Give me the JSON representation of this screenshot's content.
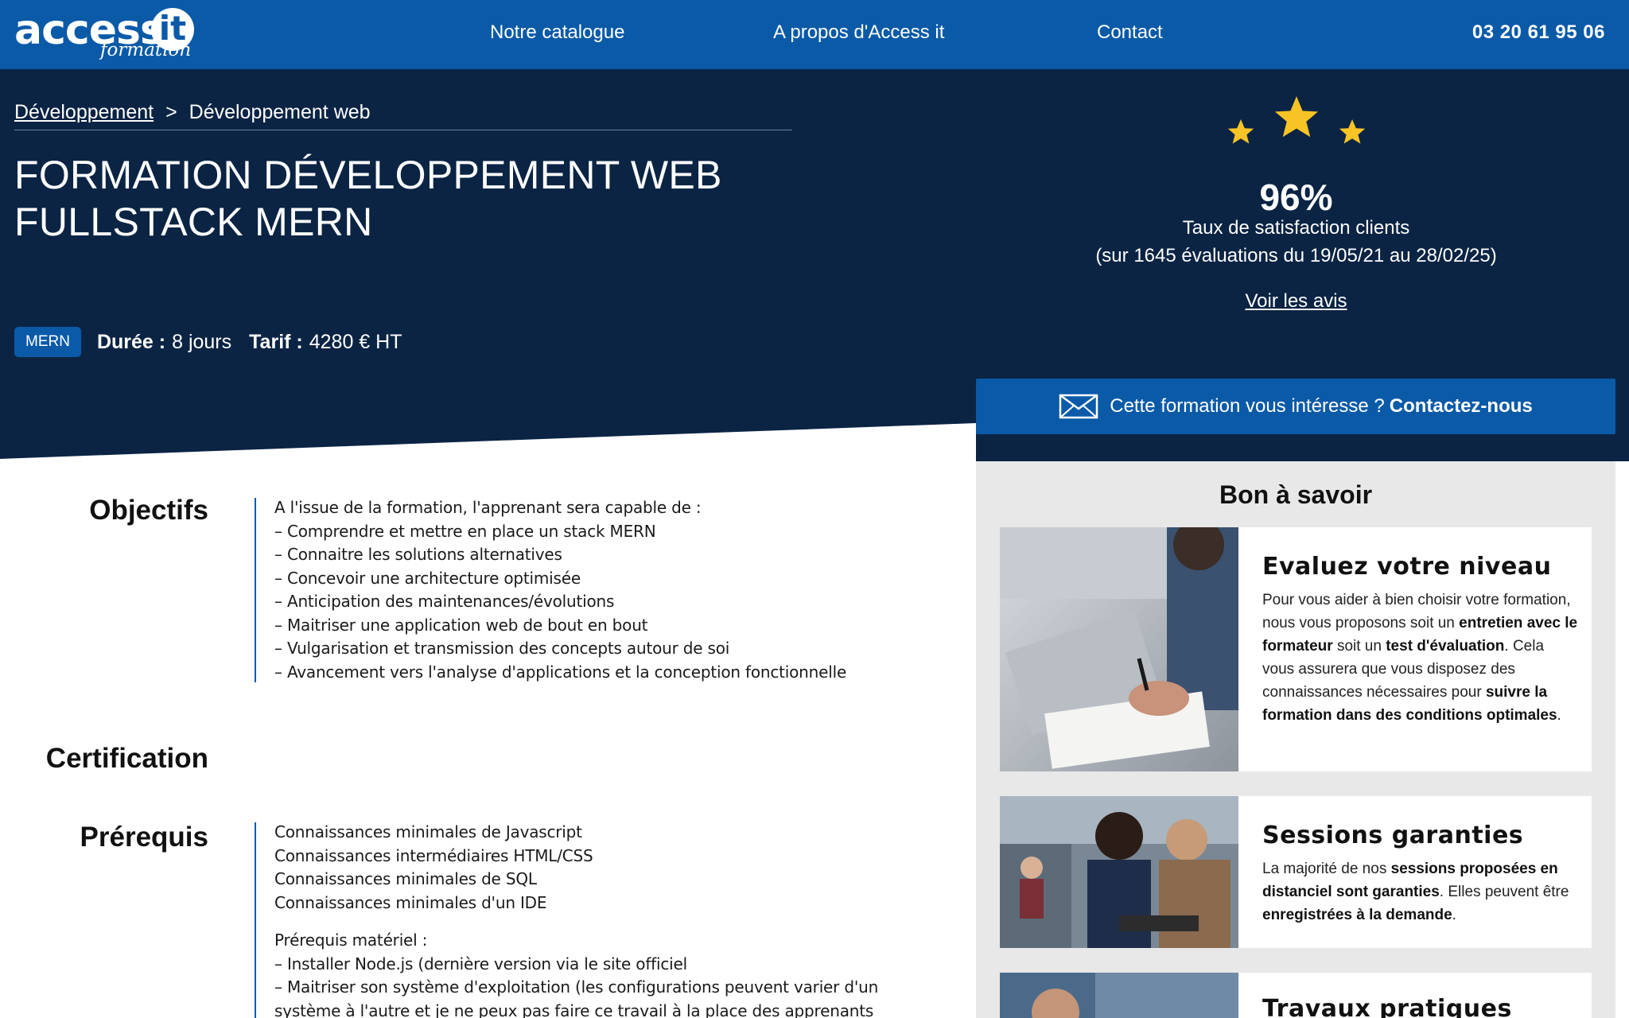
{
  "nav": {
    "logo_text": "access",
    "logo_badge": "it",
    "logo_sub": "formation",
    "links": [
      "Notre catalogue",
      "A propos d'Access it",
      "Contact"
    ],
    "phone": "03 20 61 95 06"
  },
  "breadcrumb": {
    "parent": "Développement",
    "separator": ">",
    "current": "Développement web"
  },
  "course": {
    "title_line1": "FORMATION DÉVELOPPEMENT WEB",
    "title_line2": "FULLSTACK MERN",
    "tag": "MERN",
    "duration_label": "Durée :",
    "duration_value": "8 jours",
    "price_label": "Tarif :",
    "price_value": "4280 € HT"
  },
  "rating": {
    "stars": 3,
    "percent": "96%",
    "label": "Taux de satisfaction clients",
    "range": "(sur 1645 évaluations du 19/05/21 au 28/02/25)",
    "link": "Voir les avis"
  },
  "cta": {
    "icon": "envelope-icon",
    "text": "Cette formation vous intéresse ?",
    "bold": "Contactez-nous"
  },
  "objectifs": {
    "title": "Objectifs",
    "intro": "A l'issue de la formation, l'apprenant sera capable de :",
    "items": [
      "– Comprendre et mettre en place un stack MERN",
      "– Connaitre les solutions  alternatives",
      "– Concevoir une architecture optimisée",
      "– Anticipation des maintenances/évolutions",
      "– Maitriser une application web de bout en bout",
      "– Vulgarisation et transmission des concepts autour de soi",
      "– Avancement vers l'analyse d'applications et la conception fonctionnelle"
    ]
  },
  "certification": {
    "title": "Certification"
  },
  "prerequis": {
    "title": "Prérequis",
    "items": [
      "Connaissances minimales de Javascript",
      "Connaissances intermédiaires HTML/CSS",
      "Connaissances minimales de SQL",
      "Connaissances minimales d'un IDE"
    ],
    "materiel_title": "Prérequis matériel :",
    "materiel_items": [
      "– Installer Node.js (dernière version via le site officiel",
      "– Maitriser son système d'exploitation (les configurations peuvent varier d'un",
      "système à l'autre et je ne peux pas faire ce travail à la place des apprenants"
    ]
  },
  "sidebar": {
    "title": "Bon à savoir",
    "cards": [
      {
        "title": "Evaluez votre niveau",
        "t1": "Pour vous aider à bien choisir votre formation, nous vous proposons soit un ",
        "b1": "entretien avec le formateur",
        "t2": " soit un ",
        "b2": "test d'évaluation",
        "t3": ". Cela vous assurera que vous disposez des connaissances nécessaires pour ",
        "b3": "suivre la formation dans des conditions optimales",
        "t4": "."
      },
      {
        "title": "Sessions garanties",
        "t1": "La majorité de nos ",
        "b1": "sessions proposées en distanciel sont garanties",
        "t2": ". Elles peuvent être ",
        "b2": "enregistrées à la demande",
        "t3": "."
      },
      {
        "title": "Travaux pratiques"
      }
    ]
  },
  "colors": {
    "nav_blue": "#0a5aa8",
    "hero_navy": "#0b2444",
    "star_gold": "#f7c325",
    "sidebar_gray": "#e8e8e8"
  }
}
